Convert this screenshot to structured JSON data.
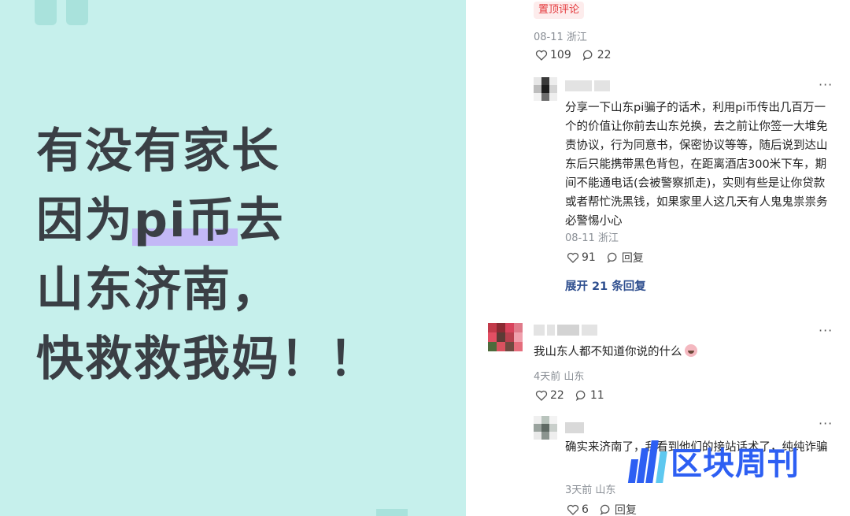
{
  "headline": {
    "line1": "有没有家长",
    "line2_pre": "因为",
    "line2_mark": "pi币",
    "line2_post": "去",
    "line3": "山东济南，",
    "line4": "快救救我妈！！"
  },
  "pinned": {
    "badge": "置顶评论",
    "meta": "08-11 浙江",
    "likes": "109",
    "comments": "22"
  },
  "reply1": {
    "text": "分享一下山东pi骗子的话术，利用pi币传出几百万一个的价值让你前去山东兑换，去之前让你签一大堆免责协议，行为同意书，保密协议等等，随后说到达山东后只能携带黑色背包，在距离酒店300米下车，期间不能通电话(会被警察抓走)，实则有些是让你贷款或者帮忙洗黑钱，如果家里人这几天有人鬼鬼祟祟务必警惕小心",
    "meta": "08-11 浙江",
    "likes": "91",
    "reply_label": "回复",
    "expand": "展开 21 条回复"
  },
  "comment2": {
    "text": "我山东人都不知道你说的什么",
    "meta": "4天前 山东",
    "likes": "22",
    "comments": "11"
  },
  "reply2": {
    "text": "确实来济南了，我看到他们的接站话术了，纯纯诈骗",
    "meta": "3天前 山东",
    "likes": "6",
    "reply_label": "回复"
  },
  "watermark": {
    "text": "区块周刊"
  },
  "more_label": "···",
  "colors": {
    "left_bg": "#c6f0ec",
    "highlight": "#c3b8f6",
    "badge_red": "#e4393c",
    "link_blue": "#2f4f8f",
    "watermark_blue": "#2d5ff3"
  }
}
